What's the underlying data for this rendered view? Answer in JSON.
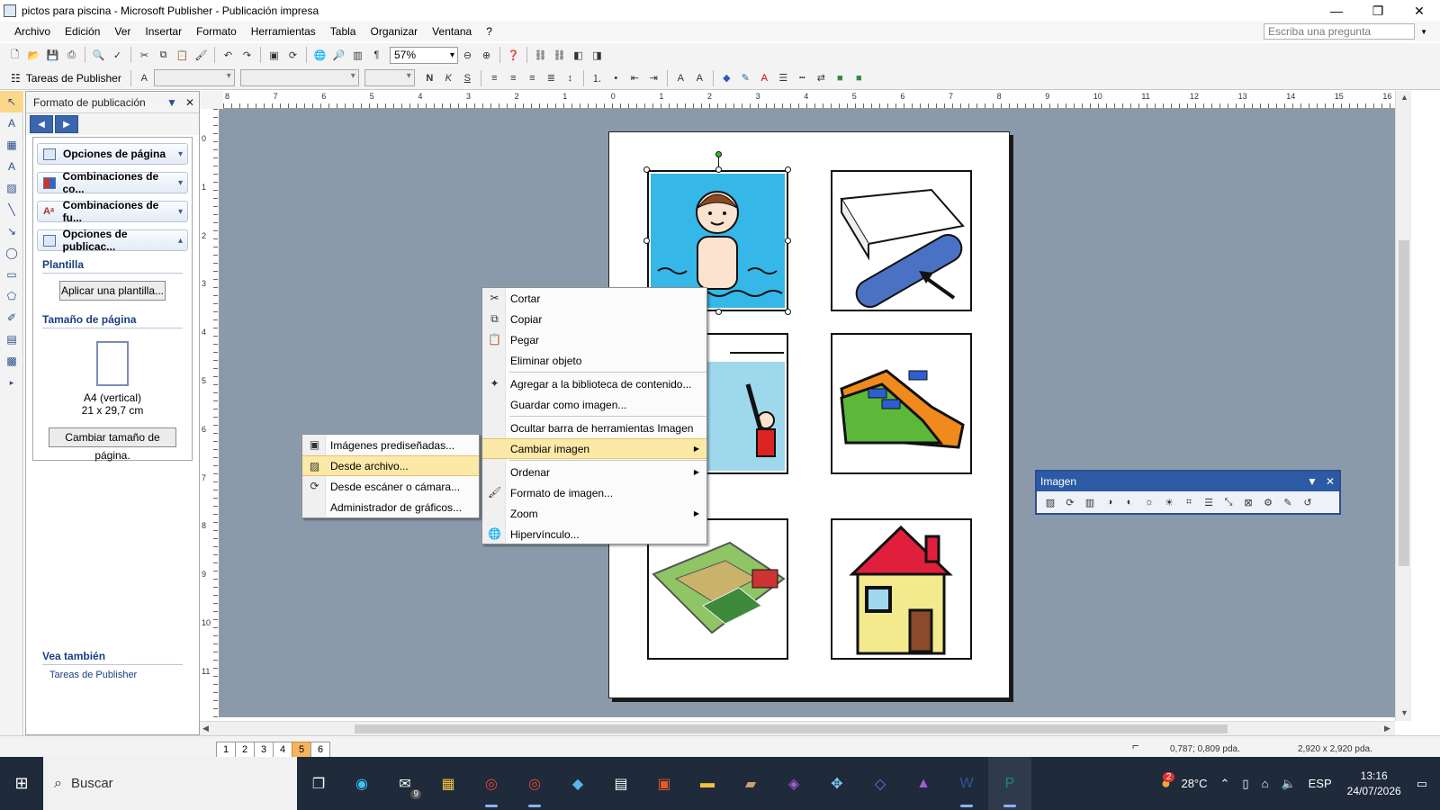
{
  "window": {
    "title": "pictos para piscina - Microsoft Publisher - Publicación impresa",
    "controls": {
      "minimize": "—",
      "restore": "❐",
      "close": "✕"
    }
  },
  "menubar": {
    "items": [
      "Archivo",
      "Edición",
      "Ver",
      "Insertar",
      "Formato",
      "Herramientas",
      "Tabla",
      "Organizar",
      "Ventana",
      "?"
    ],
    "ask_placeholder": "Escriba una pregunta"
  },
  "toolbar": {
    "zoom": "57%",
    "tasks_label": "Tareas de Publisher"
  },
  "taskpane": {
    "title": "Formato de publicación",
    "sections": [
      {
        "label": "Opciones de página",
        "icon": "page-icon"
      },
      {
        "label": "Combinaciones de co...",
        "icon": "color-scheme-icon"
      },
      {
        "label": "Combinaciones de fu...",
        "icon": "font-scheme-icon"
      },
      {
        "label": "Opciones de publicac...",
        "icon": "publication-icon"
      }
    ],
    "plantilla_title": "Plantilla",
    "apply_template_btn": "Aplicar una plantilla...",
    "page_size_title": "Tamaño de página",
    "page_size_name": "A4 (vertical)",
    "page_size_dims": "21 x 29,7 cm",
    "change_size_btn": "Cambiar tamaño de página.",
    "see_also_title": "Vea también",
    "see_also_link": "Tareas de Publisher"
  },
  "rulers": {
    "h_marks": [
      "8",
      "7",
      "6",
      "5",
      "4",
      "3",
      "2",
      "1",
      "0",
      "1",
      "2",
      "3",
      "4",
      "5",
      "6",
      "7",
      "8",
      "9",
      "10",
      "11",
      "12",
      "13",
      "14",
      "15",
      "16"
    ],
    "v_marks": [
      "0",
      "1",
      "2",
      "3",
      "4",
      "5",
      "6",
      "7",
      "8",
      "9",
      "10",
      "11"
    ]
  },
  "context_menu": {
    "items": [
      {
        "label": "Cortar",
        "icon": "scissors-icon"
      },
      {
        "label": "Copiar",
        "icon": "copy-icon"
      },
      {
        "label": "Pegar",
        "icon": "paste-icon"
      },
      {
        "label": "Eliminar objeto",
        "icon": ""
      },
      {
        "label": "Agregar a la biblioteca de contenido...",
        "icon": "library-icon"
      },
      {
        "label": "Guardar como imagen...",
        "icon": ""
      },
      {
        "label": "Ocultar barra de herramientas Imagen",
        "icon": ""
      },
      {
        "label": "Cambiar imagen",
        "icon": "",
        "submenu": true,
        "highlighted": true
      },
      {
        "label": "Ordenar",
        "icon": "",
        "submenu": true
      },
      {
        "label": "Formato de imagen...",
        "icon": "format-picture-icon"
      },
      {
        "label": "Zoom",
        "icon": "",
        "submenu": true
      },
      {
        "label": "Hipervínculo...",
        "icon": "hyperlink-icon"
      }
    ]
  },
  "submenu": {
    "items": [
      {
        "label": "Imágenes prediseñadas...",
        "icon": "clipart-icon"
      },
      {
        "label": "Desde archivo...",
        "icon": "from-file-icon",
        "highlighted": true
      },
      {
        "label": "Desde escáner o cámara...",
        "icon": "scanner-icon"
      },
      {
        "label": "Administrador de gráficos...",
        "icon": ""
      }
    ]
  },
  "image_toolbar": {
    "title": "Imagen"
  },
  "statusbar": {
    "pages": [
      "1",
      "2",
      "3",
      "4",
      "5",
      "6"
    ],
    "active_page": "5",
    "position": "0,787; 0,809 pda.",
    "size": "2,920 x 2,920 pda."
  },
  "taskbar": {
    "search_placeholder": "Buscar",
    "mail_badge": "9",
    "weather_badge": "2",
    "temperature": "28°C",
    "language": "ESP",
    "time": "13:16",
    "date": "24/07/2026"
  }
}
